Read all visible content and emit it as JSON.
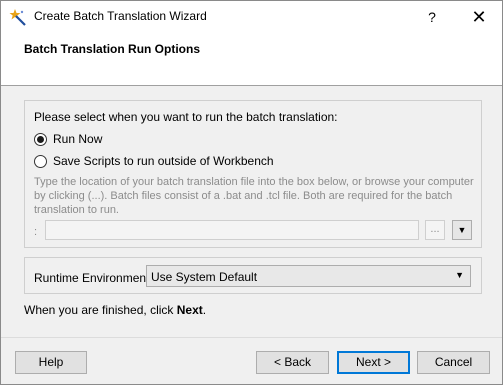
{
  "window": {
    "title": "Create Batch Translation Wizard",
    "help_glyph": "?",
    "close_glyph": "✕",
    "icon": "wizard-star-icon"
  },
  "header": {
    "title": "Batch Translation Run Options"
  },
  "options": {
    "prompt": "Please select when you want to run the batch translation:",
    "radios": [
      {
        "label": "Run Now",
        "checked": true
      },
      {
        "label": "Save Scripts to run outside of Workbench",
        "checked": false
      }
    ],
    "help_text": "Type the location of your batch translation file into the box below, or browse your computer by clicking (...). Batch files consist of a .bat and .tcl file. Both are required for the batch translation to run.",
    "path_colon": ":",
    "path_value": "",
    "browse_label": "...",
    "dropdown_glyph": "▼"
  },
  "runtime": {
    "label": "Runtime Environment:",
    "selected": "Use System Default",
    "arrow": "▼"
  },
  "finish": {
    "text_prefix": "When you are finished, click ",
    "text_bold": "Next",
    "text_suffix": "."
  },
  "buttons": {
    "help": "Help",
    "back": "< Back",
    "next": "Next >",
    "cancel": "Cancel"
  },
  "colors": {
    "accent": "#0078d7",
    "disabled_text": "#8c8c8c"
  }
}
